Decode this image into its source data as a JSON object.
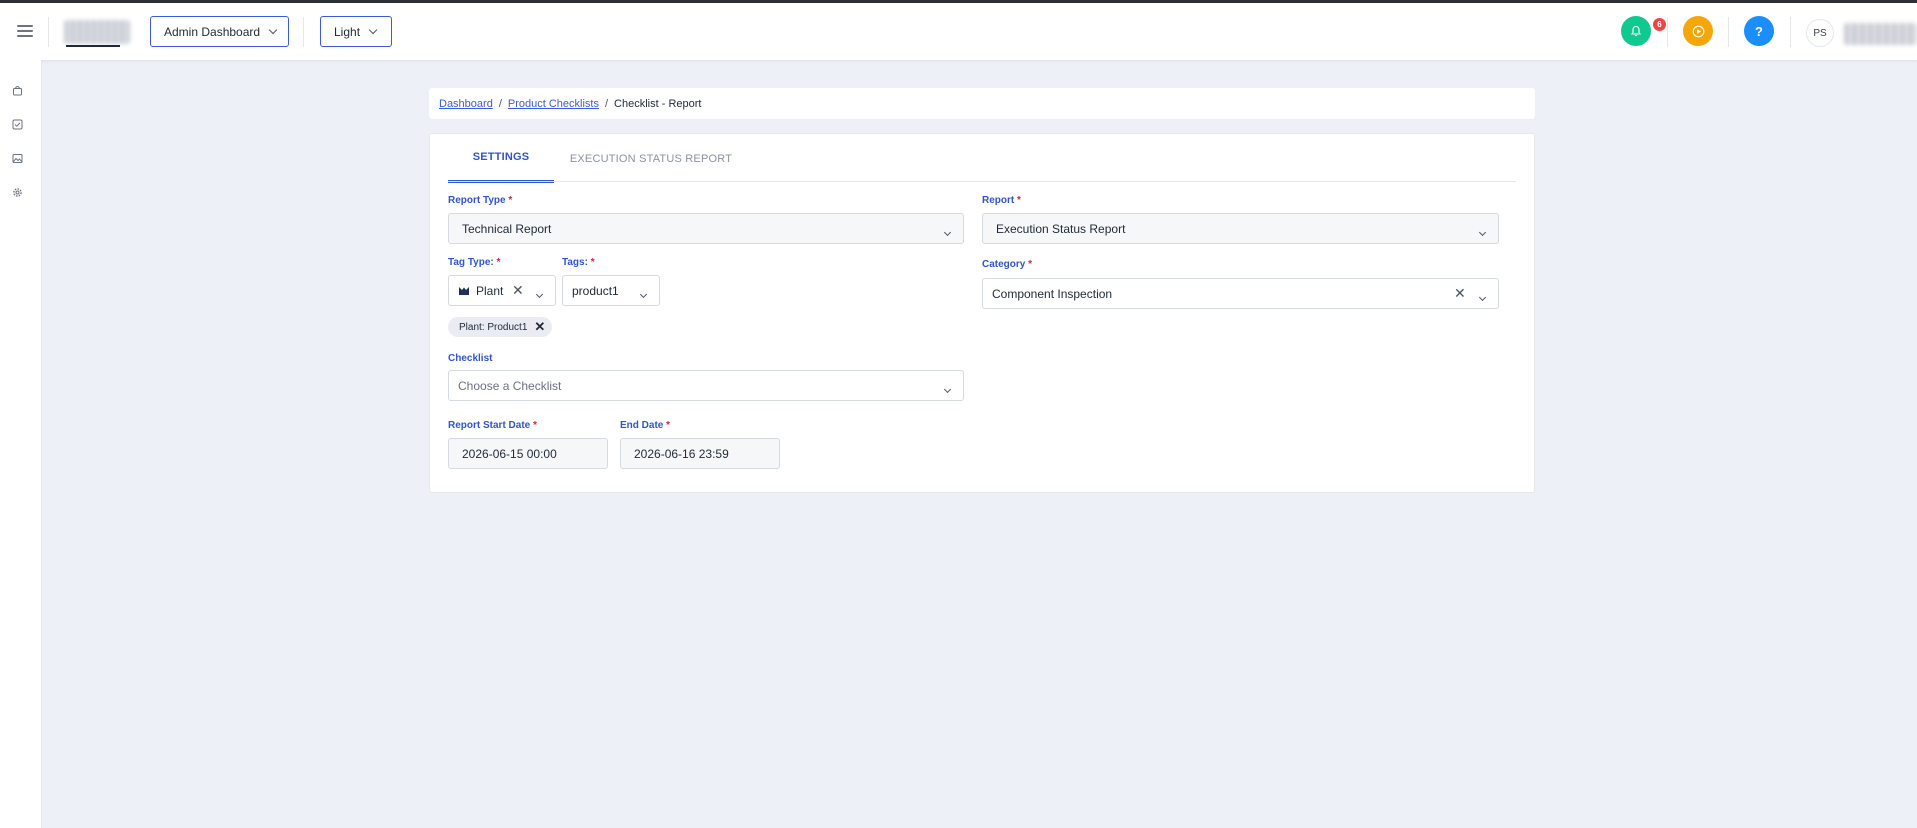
{
  "topbar": {
    "dashboard_select": "Admin Dashboard",
    "theme_select": "Light",
    "notification_count": "6",
    "help_label": "?",
    "avatar_initials": "PS"
  },
  "breadcrumb": {
    "items": [
      "Dashboard",
      "Product Checklists"
    ],
    "separator": "/",
    "current": "Checklist - Report"
  },
  "tabs": [
    {
      "label": "SETTINGS",
      "active": true
    },
    {
      "label": "EXECUTION STATUS REPORT",
      "active": false
    }
  ],
  "form": {
    "report_type": {
      "label": "Report Type",
      "required": "*",
      "value": "Technical Report"
    },
    "report": {
      "label": "Report",
      "required": "*",
      "value": "Execution Status Report"
    },
    "tag_type": {
      "label": "Tag Type:",
      "required": "*",
      "value": "Plant"
    },
    "tags": {
      "label": "Tags:",
      "required": "*",
      "value": "product1"
    },
    "category": {
      "label": "Category",
      "required": "*",
      "value": "Component Inspection"
    },
    "selected_chip": "Plant: Product1",
    "checklist": {
      "label": "Checklist",
      "placeholder": "Choose a Checklist"
    },
    "start_date": {
      "label": "Report Start Date",
      "required": "*",
      "value": "2026-06-15 00:00"
    },
    "end_date": {
      "label": "End Date",
      "required": "*",
      "value": "2026-06-16 23:59"
    }
  },
  "colors": {
    "accent": "#2f54d6",
    "notification_button": "#10c98f",
    "play_button": "#f6a609",
    "help_button": "#1c8ef9",
    "badge": "#ef4444"
  },
  "icons": {
    "sidebar": [
      "bag-icon",
      "checklist-icon",
      "image-icon",
      "settings-icon"
    ],
    "topbar": [
      "hamburger-icon",
      "bell-icon",
      "play-icon",
      "help-icon"
    ]
  }
}
